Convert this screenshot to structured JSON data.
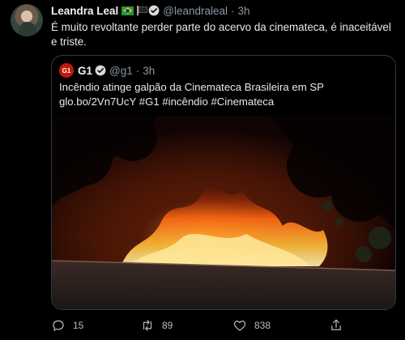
{
  "tweet": {
    "author": {
      "name": "Leandra Leal",
      "handle": "@leandraleal",
      "time": "3h"
    },
    "separator": "·",
    "text": "É muito revoltante perder parte do acervo da cinemateca, é inaceitável e triste.",
    "quoted": {
      "logo_text": "G1",
      "name": "G1",
      "handle": "@g1",
      "time": "3h",
      "text_line1": "Incêndio atinge galpão da Cinemateca Brasileira em SP",
      "text_line2": "glo.bo/2Vn7UcY #G1 #incêndio #Cinemateca"
    },
    "actions": {
      "replies": "15",
      "retweets": "89",
      "likes": "838"
    }
  },
  "colors": {
    "background": "#000000",
    "secondary_text": "#8b98a5",
    "verified": "#d9d9d9",
    "g1_red": "#c4170c",
    "fire": "#ff7a1a"
  },
  "icons": [
    "avatar",
    "brazil-flag-icon",
    "black-flag-icon",
    "verified-icon",
    "g1-logo",
    "reply-icon",
    "retweet-icon",
    "like-icon",
    "share-icon"
  ]
}
